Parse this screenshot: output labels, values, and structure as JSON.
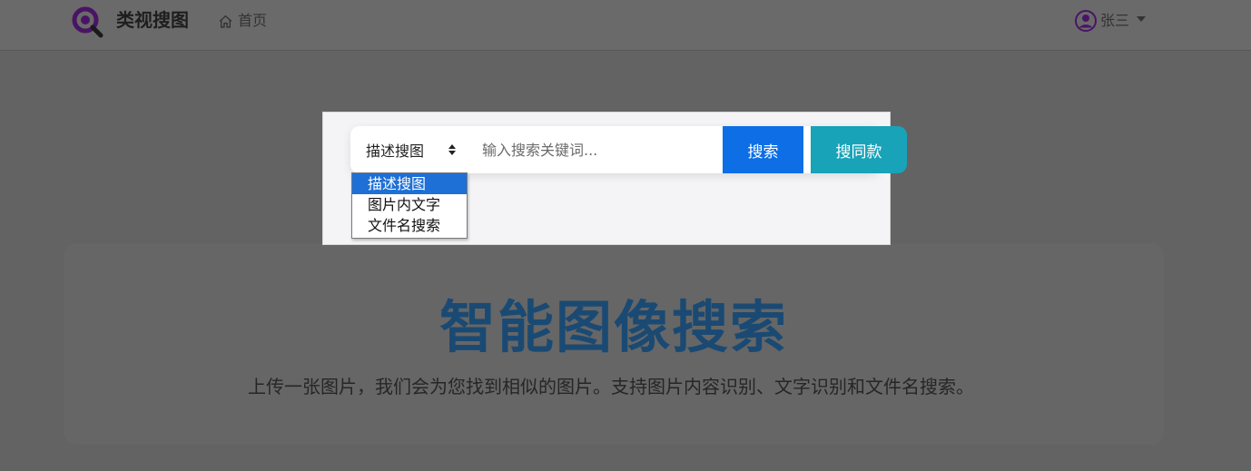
{
  "navbar": {
    "brand_text": "类视搜图",
    "home_label": "首页",
    "user_name": "张三"
  },
  "modal": {
    "mode_selected": "描述搜图",
    "search_placeholder": "输入搜索关键词...",
    "search_button": "搜索",
    "same_style_button": "搜同款"
  },
  "dropdown": {
    "options": [
      "描述搜图",
      "图片内文字",
      "文件名搜索"
    ],
    "selected_index": 0
  },
  "hero": {
    "title": "智能图像搜索",
    "subtitle": "上传一张图片，我们会为您找到相似的图片。支持图片内容识别、文字识别和文件名搜索。"
  },
  "colors": {
    "primary": "#0d6ee6",
    "info": "#18a3b9",
    "brand_purple": "#6a1b9a",
    "hero_title": "#1a4a73",
    "dropdown_highlight": "#1e6fd6"
  }
}
